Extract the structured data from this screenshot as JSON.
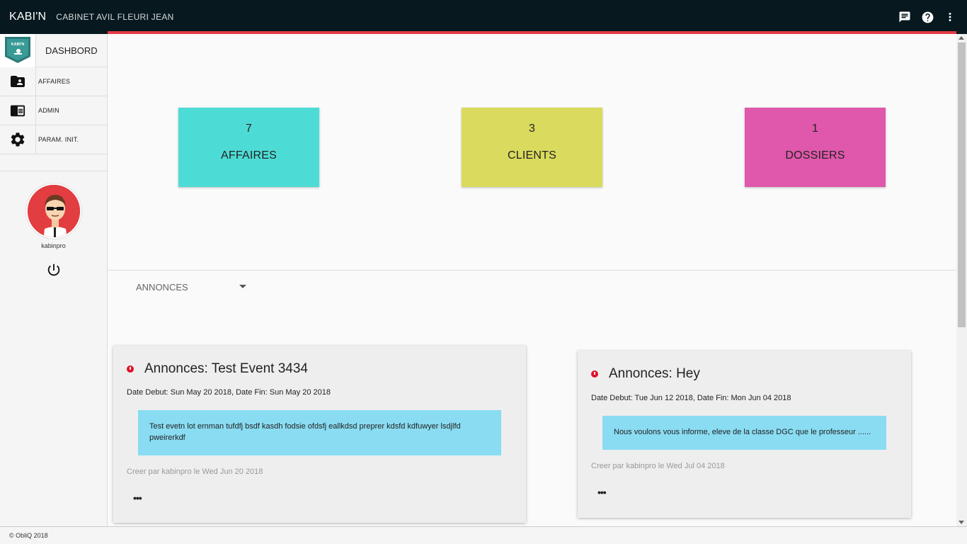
{
  "header": {
    "brand": "KABI'N",
    "subtitle": "CABINET AVIL FLEURI JEAN"
  },
  "icons": {
    "messages": "message-icon",
    "help": "help-icon",
    "menu": "more-vert-icon"
  },
  "sidebar": {
    "logo_text": "KABI'N",
    "dashboard_label": "DASHBORD",
    "items": [
      {
        "label": "AFFAIRES",
        "icon": "folder-shared-icon"
      },
      {
        "label": "ADMIN",
        "icon": "chrome-reader-mode-icon"
      },
      {
        "label": "PARAM. INIT.",
        "icon": "settings-icon"
      }
    ],
    "username": "kabinpro"
  },
  "stats": [
    {
      "count": "7",
      "label": "AFFAIRES",
      "color": "#4ddcd5"
    },
    {
      "count": "3",
      "label": "CLIENTS",
      "color": "#dada5e"
    },
    {
      "count": "1",
      "label": "DOSSIERS",
      "color": "#df58ab"
    }
  ],
  "filter": {
    "selected": "ANNONCES"
  },
  "announcements": [
    {
      "title": "Annonces: Test Event 3434",
      "dates": "Date Debut: Sun May 20 2018, Date Fin: Sun May 20 2018",
      "body": "Test evetn lot ernman tufdfj bsdf kasdh fodsie ofdsfj eallkdsd preprer kdsfd kdfuwyer lsdjlfd pweirerkdf",
      "meta": "Creer par kabinpro le Wed Jun 20 2018",
      "more": "•••"
    },
    {
      "title": "Annonces: Hey",
      "dates": "Date Debut: Tue Jun 12 2018, Date Fin: Mon Jun 04 2018",
      "body": "Nous voulons vous informe, eleve de la classe DGC que le professeur ......",
      "meta": "Creer par kabinpro le Wed Jul 04 2018",
      "more": "•••"
    }
  ],
  "footer": {
    "text": "© ObliQ 2018"
  },
  "colors": {
    "topbar": "#07191f",
    "accent_line": "#e53946",
    "announcement_body": "#89dcf2",
    "alert_dot": "#e0102b"
  }
}
